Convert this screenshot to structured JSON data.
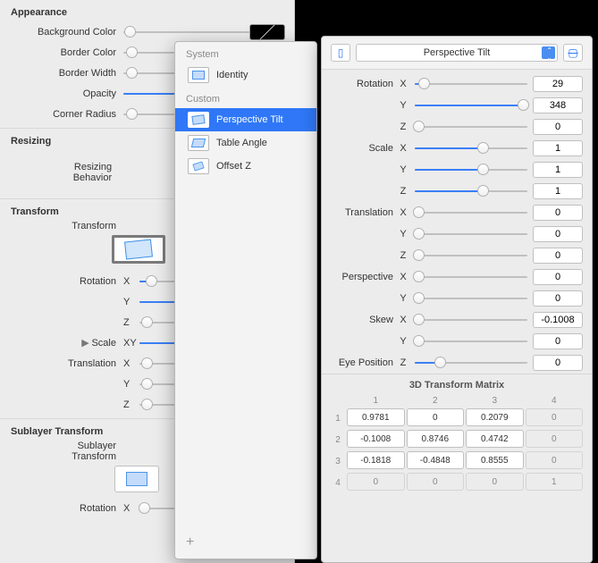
{
  "left": {
    "appearance": {
      "header": "Appearance",
      "bgColor": "Background Color",
      "borderColor": "Border Color",
      "borderWidth": "Border Width",
      "opacity": "Opacity",
      "cornerRadius": "Corner Radius"
    },
    "resizing": {
      "header": "Resizing",
      "behavior": "Resizing\nBehavior"
    },
    "transform": {
      "header": "Transform",
      "label": "Transform",
      "rotation": "Rotation",
      "scale": "Scale",
      "translation": "Translation",
      "sublayerHeader": "Sublayer Transform",
      "sublayer": "Sublayer\nTransform"
    },
    "values": {
      "subRotationX": "0"
    }
  },
  "popup": {
    "system": "System",
    "custom": "Custom",
    "identity": "Identity",
    "perspectiveTilt": "Perspective Tilt",
    "tableAngle": "Table Angle",
    "offsetZ": "Offset Z",
    "add": "+"
  },
  "right": {
    "selectLabel": "Perspective Tilt",
    "groups": {
      "rotation": "Rotation",
      "scale": "Scale",
      "translation": "Translation",
      "perspective": "Perspective",
      "skew": "Skew",
      "eyePosition": "Eye Position"
    },
    "axis": {
      "x": "X",
      "y": "Y",
      "z": "Z",
      "xy": "XY"
    },
    "vals": {
      "rotX": "29",
      "rotY": "348",
      "rotZ": "0",
      "scaleX": "1",
      "scaleY": "1",
      "scaleZ": "1",
      "transX": "0",
      "transY": "0",
      "transZ": "0",
      "perspX": "0",
      "perspY": "0",
      "skewX": "-0.1008",
      "skewY": "0",
      "eyeZ": "0"
    },
    "matrixTitle": "3D Transform Matrix",
    "matrix": {
      "r1": [
        "0.9781",
        "0",
        "0.2079",
        "0"
      ],
      "r2": [
        "-0.1008",
        "0.8746",
        "0.4742",
        "0"
      ],
      "r3": [
        "-0.1818",
        "-0.4848",
        "0.8555",
        "0"
      ],
      "r4": [
        "0",
        "0",
        "0",
        "1"
      ]
    },
    "colHdr": [
      "1",
      "2",
      "3",
      "4"
    ],
    "rowHdr": [
      "1",
      "2",
      "3",
      "4"
    ]
  },
  "chart_data": null
}
